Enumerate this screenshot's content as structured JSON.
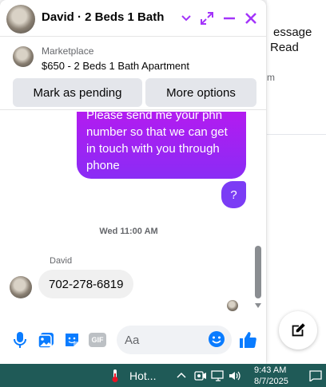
{
  "background": {
    "line1": "essage",
    "line2": "Read",
    "line3": "m",
    "compose_icon": "compose-icon"
  },
  "chat": {
    "title": "David · 2 Beds 1 Bath",
    "listing": {
      "source": "Marketplace",
      "title": "$650 - 2 Beds 1 Bath Apartment",
      "button_pending": "Mark as pending",
      "button_more": "More options"
    },
    "messages": {
      "outgoing_line1": "Please send me your phn",
      "outgoing_line2": "number so that we can get",
      "outgoing_line3": "in touch with you through",
      "outgoing_line4": "phone",
      "outgoing_short": "?",
      "timestamp": "Wed 11:00 AM",
      "sender": "David",
      "incoming": "702-278-6819"
    },
    "composer": {
      "placeholder": "Aa",
      "gif_label": "GIF"
    },
    "colors": {
      "accent": "#a334fa",
      "like": "#0a7cff",
      "bubble_gradient_top": "#b31bf0",
      "bubble_gradient_bottom": "#8a2cf5"
    }
  },
  "taskbar": {
    "weather_label": "Hot...",
    "time": "9:43 AM",
    "date": "8/7/2025"
  }
}
